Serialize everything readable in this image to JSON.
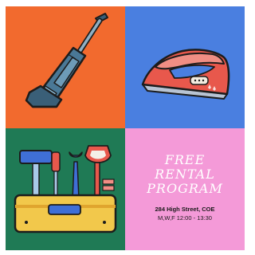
{
  "poster": {
    "headline_lines": [
      "FREE",
      "RENTAL",
      "PROGRAM"
    ],
    "address": "284 High Street, COE",
    "hours": "M,W,F 12:00 - 13:30"
  },
  "colors": {
    "orange": "#f26a2e",
    "blue": "#4a7fe0",
    "green": "#1f7a55",
    "pink": "#f49ad8",
    "vacuum_body": "#4a7896",
    "iron_red": "#e8584c",
    "toolbox_yellow": "#f2c84b"
  },
  "icons": {
    "top_left": "vacuum-cleaner-icon",
    "top_right": "clothes-iron-icon",
    "bottom_left": "toolbox-icon"
  }
}
